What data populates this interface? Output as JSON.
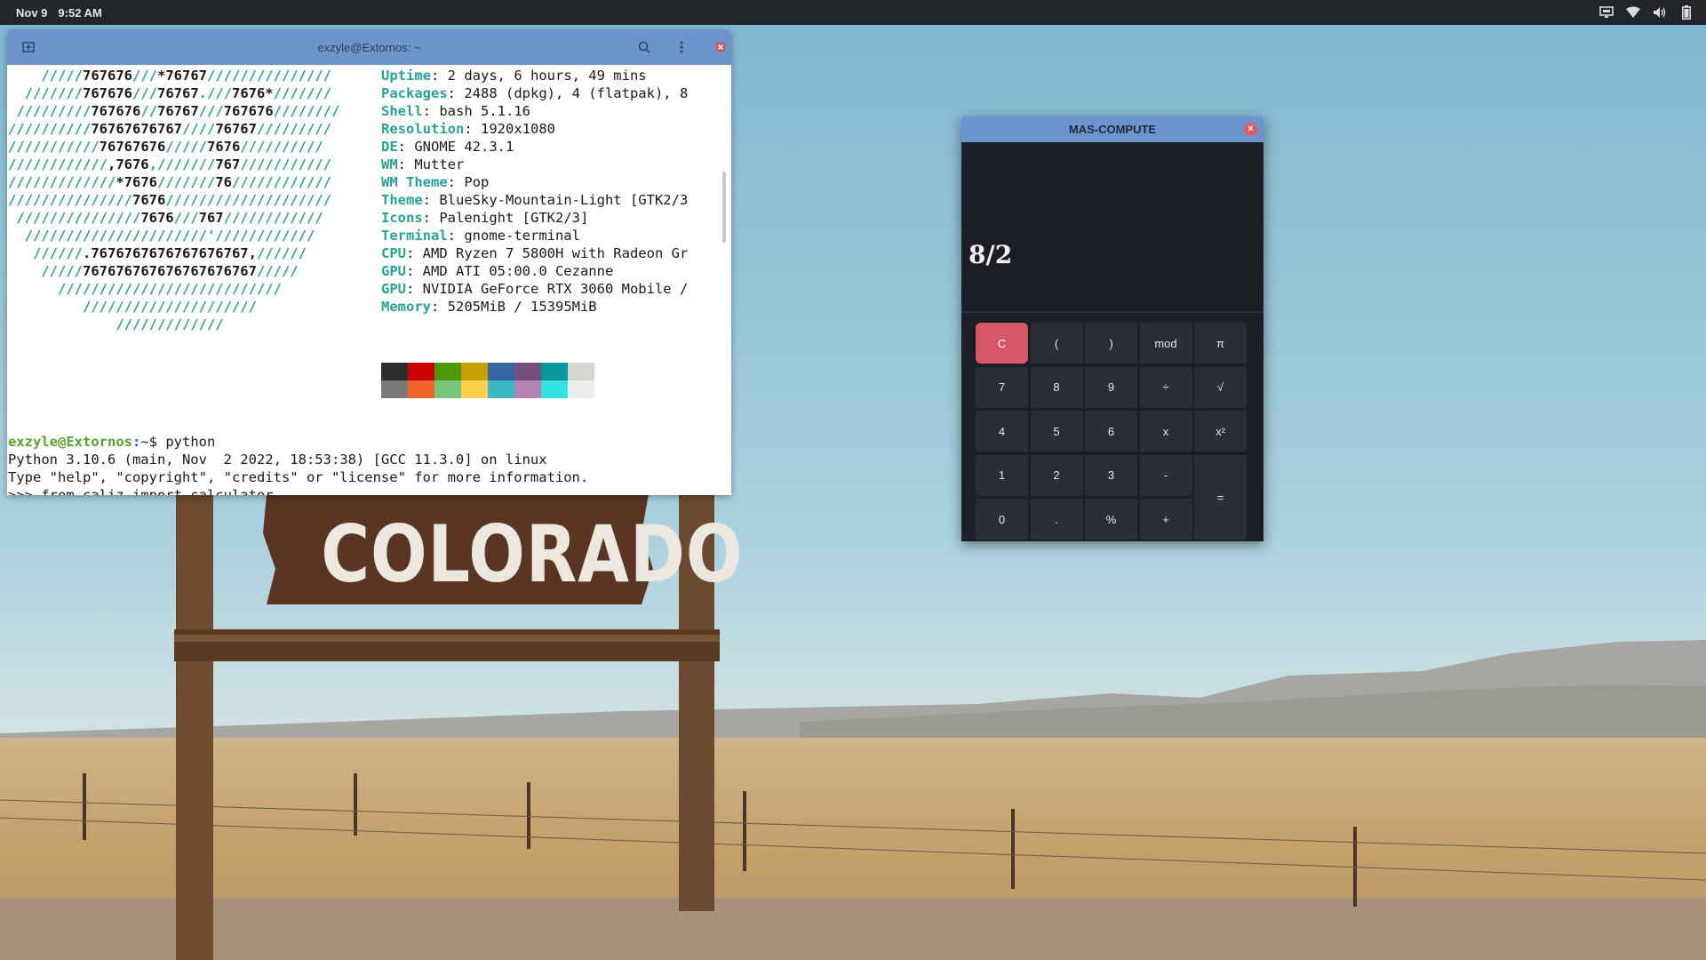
{
  "topbar": {
    "date": "Nov 9",
    "time": "9:52 AM",
    "tray_icons": [
      "monitor-icon",
      "wifi-icon",
      "volume-icon",
      "battery-icon"
    ]
  },
  "wallpaper": {
    "sign_text": "COLORADO"
  },
  "terminal": {
    "title": "exzyle@Extornos: ~",
    "logo_lines": [
      [
        "    /////",
        "767676",
        "///",
        "*76767",
        "///////////////"
      ],
      [
        "  ///////",
        "767676",
        "///",
        "76767",
        ".///",
        "7676*",
        "///////"
      ],
      [
        " /////////",
        "767676",
        "//",
        "76767",
        "///",
        "767676",
        "////////"
      ],
      [
        "//////////",
        "76767676767",
        "////",
        "76767",
        "/////////"
      ],
      [
        "///////////",
        "76767676",
        "/////",
        "7676",
        "//////////"
      ],
      [
        "////////////",
        ",7676",
        ",///////",
        "767",
        "///////////"
      ],
      [
        "/////////////",
        "*7676",
        "///////",
        "76",
        "////////////"
      ],
      [
        "///////////////",
        "7676",
        "////////////////////"
      ],
      [
        " ///////////////",
        "7676",
        "///",
        "767",
        "////////////"
      ],
      [
        "  //////////////////////'////////////",
        "",
        ""
      ],
      [
        "   //////",
        ".7676767676767676767,",
        "//////"
      ],
      [
        "    /////",
        "767676767676767676767",
        "/////"
      ],
      [
        "      ///////////////////////////",
        "",
        ""
      ],
      [
        "         /////////////////////",
        "",
        ""
      ],
      [
        "             /////////////",
        "",
        ""
      ]
    ],
    "info": [
      {
        "key": "Uptime",
        "value": "2 days, 6 hours, 49 mins"
      },
      {
        "key": "Packages",
        "value": "2488 (dpkg), 4 (flatpak), 8"
      },
      {
        "key": "Shell",
        "value": "bash 5.1.16"
      },
      {
        "key": "Resolution",
        "value": "1920x1080"
      },
      {
        "key": "DE",
        "value": "GNOME 42.3.1"
      },
      {
        "key": "WM",
        "value": "Mutter"
      },
      {
        "key": "WM Theme",
        "value": "Pop"
      },
      {
        "key": "Theme",
        "value": "BlueSky-Mountain-Light [GTK2/3"
      },
      {
        "key": "Icons",
        "value": "Palenight [GTK2/3]"
      },
      {
        "key": "Terminal",
        "value": "gnome-terminal"
      },
      {
        "key": "CPU",
        "value": "AMD Ryzen 7 5800H with Radeon Gr"
      },
      {
        "key": "GPU",
        "value": "AMD ATI 05:00.0 Cezanne"
      },
      {
        "key": "GPU",
        "value": "NVIDIA GeForce RTX 3060 Mobile /"
      },
      {
        "key": "Memory",
        "value": "5205MiB / 15395MiB"
      }
    ],
    "palette_top": [
      "#2e2e2e",
      "#cc0000",
      "#4e9a06",
      "#c4a000",
      "#3465a4",
      "#75507b",
      "#06989a",
      "#d3d7cf"
    ],
    "palette_bottom": [
      "#7a7a7a",
      "#f2622a",
      "#79c47b",
      "#fcd04d",
      "#3db7c4",
      "#b584b7",
      "#34e2e2",
      "#eeeeec"
    ],
    "shell": {
      "user": "exzyle@Extornos",
      "path": ":~",
      "command": "$ python",
      "out1": "Python 3.10.6 (main, Nov  2 2022, 18:53:38) [GCC 11.3.0] on linux",
      "out2": "Type \"help\", \"copyright\", \"credits\" or \"license\" for more information.",
      "out3": ">>> from caliz import calculator"
    }
  },
  "calculator": {
    "title": "MAS-COMPUTE",
    "close": "×",
    "expression": "8/2",
    "keys": [
      {
        "label": "C",
        "name": "clear-button"
      },
      {
        "label": "(",
        "name": "open-paren-button"
      },
      {
        "label": ")",
        "name": "close-paren-button"
      },
      {
        "label": "mod",
        "name": "mod-button"
      },
      {
        "label": "π",
        "name": "pi-button"
      },
      {
        "label": "7",
        "name": "digit-7-button"
      },
      {
        "label": "8",
        "name": "digit-8-button"
      },
      {
        "label": "9",
        "name": "digit-9-button"
      },
      {
        "label": "÷",
        "name": "divide-button"
      },
      {
        "label": "√",
        "name": "sqrt-button"
      },
      {
        "label": "4",
        "name": "digit-4-button"
      },
      {
        "label": "5",
        "name": "digit-5-button"
      },
      {
        "label": "6",
        "name": "digit-6-button"
      },
      {
        "label": "x",
        "name": "multiply-button"
      },
      {
        "label": "x²",
        "name": "square-button"
      },
      {
        "label": "1",
        "name": "digit-1-button"
      },
      {
        "label": "2",
        "name": "digit-2-button"
      },
      {
        "label": "3",
        "name": "digit-3-button"
      },
      {
        "label": "-",
        "name": "minus-button"
      },
      {
        "label": "=",
        "name": "equals-button"
      },
      {
        "label": "0",
        "name": "digit-0-button"
      },
      {
        "label": ".",
        "name": "decimal-button"
      },
      {
        "label": "%",
        "name": "percent-button"
      },
      {
        "label": "+",
        "name": "plus-button"
      }
    ]
  }
}
